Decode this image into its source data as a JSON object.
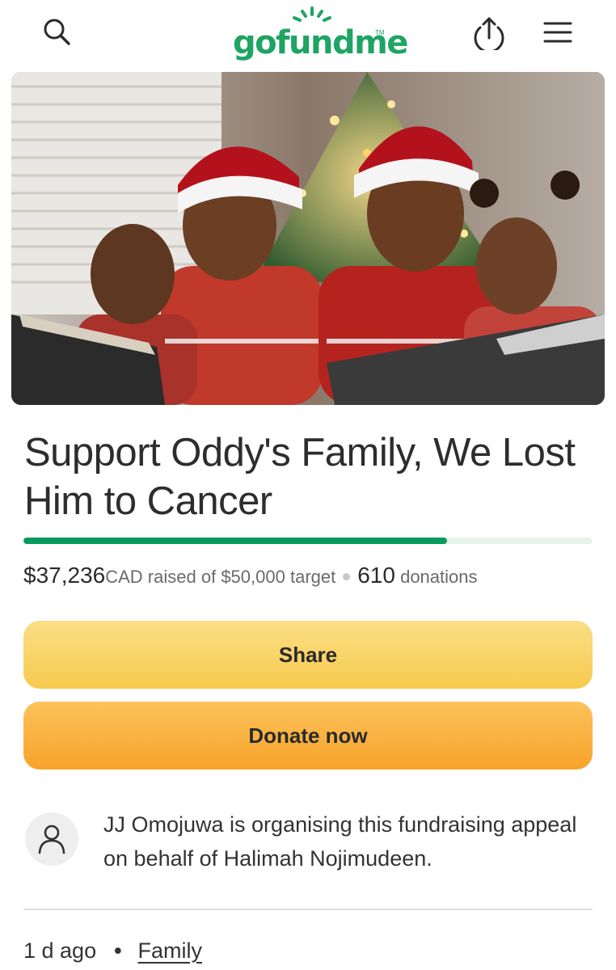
{
  "header": {
    "logo_text": "gofundme",
    "logo_tm": "TM",
    "icons": [
      "search-icon",
      "share-icon",
      "menu-icon"
    ],
    "brand_color": "#1fa463"
  },
  "campaign": {
    "title": "Support Oddy's Family, We Lost Him to Cancer",
    "amount_raised": "$37,236",
    "currency": "CAD",
    "raised_of": "raised of",
    "target": "$50,000",
    "target_word": "target",
    "donation_count": "610",
    "donations_word": "donations",
    "progress_fraction": 0.745,
    "progress_color": "#079a5f"
  },
  "actions": {
    "share_label": "Share",
    "donate_label": "Donate now"
  },
  "organiser": {
    "text": "JJ Omojuwa is organising this fundraising appeal on behalf of Halimah Nojimudeen.",
    "avatar_icon": "user-icon"
  },
  "meta": {
    "age": "1 d ago",
    "separator": "•",
    "category": "Family"
  }
}
